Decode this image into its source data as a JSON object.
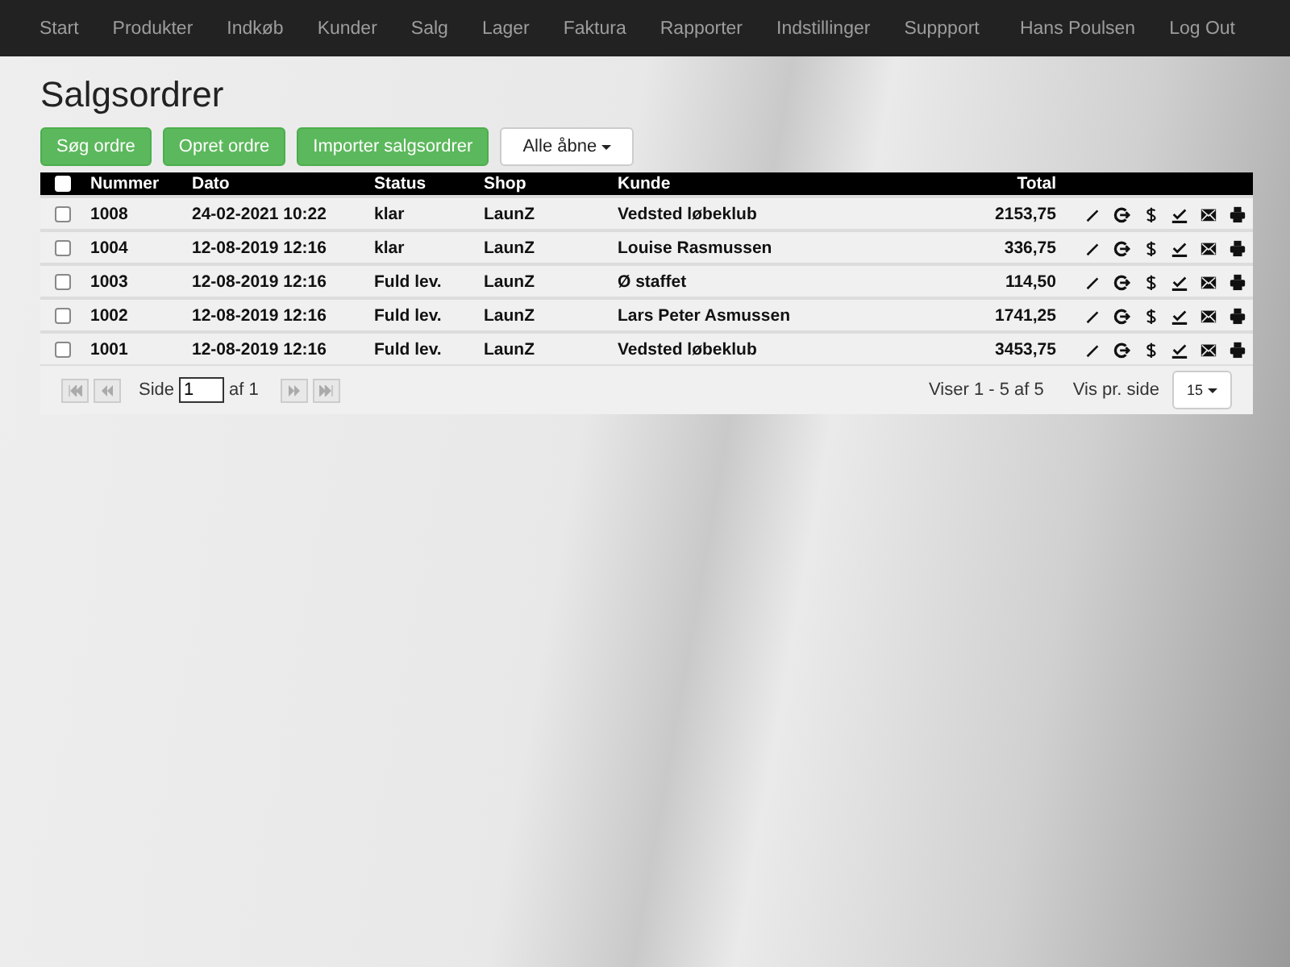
{
  "navbar": {
    "items": [
      "Start",
      "Produkter",
      "Indkøb",
      "Kunder",
      "Salg",
      "Lager",
      "Faktura",
      "Rapporter",
      "Indstillinger",
      "Suppport"
    ],
    "user": "Hans Poulsen",
    "logout": "Log Out"
  },
  "page_title": "Salgsordrer",
  "toolbar": {
    "buttons": [
      "Søg ordre",
      "Opret ordre",
      "Importer salgsordrer"
    ],
    "filter": "Alle åbne"
  },
  "table": {
    "select_all_checked": false,
    "columns": [
      "Nummer",
      "Dato",
      "Status",
      "Shop",
      "Kunde",
      "Total"
    ],
    "rows": [
      {
        "checked": false,
        "cells": [
          "1008",
          "24-02-2021 10:22",
          "klar",
          "LaunZ",
          "Vedsted løbeklub",
          "2153,75"
        ]
      },
      {
        "checked": false,
        "cells": [
          "1004",
          "12-08-2019 12:16",
          "klar",
          "LaunZ",
          "Louise Rasmussen",
          "336,75"
        ]
      },
      {
        "checked": false,
        "cells": [
          "1003",
          "12-08-2019 12:16",
          "Fuld lev.",
          "LaunZ",
          "Ø staffet",
          "114,50"
        ]
      },
      {
        "checked": false,
        "cells": [
          "1002",
          "12-08-2019 12:16",
          "Fuld lev.",
          "LaunZ",
          "Lars Peter Asmussen",
          "1741,25"
        ]
      },
      {
        "checked": false,
        "cells": [
          "1001",
          "12-08-2019 12:16",
          "Fuld lev.",
          "LaunZ",
          "Vedsted løbeklub",
          "3453,75"
        ]
      }
    ]
  },
  "pager": {
    "page_label": "Side",
    "page": "1",
    "of_label": "af 1",
    "showing": "Viser 1 - 5 af 5",
    "per_page_label": "Vis pr. side",
    "per_page": "15"
  }
}
